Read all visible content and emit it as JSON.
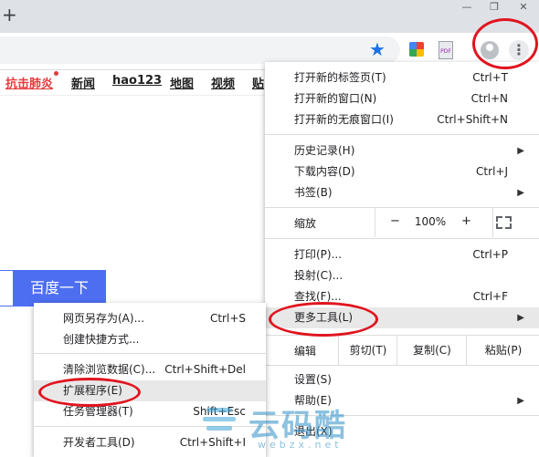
{
  "tabstrip": {
    "new_tab_symbol": "+"
  },
  "toolbar": {
    "star_icon": "star-icon",
    "kebab_glyph": "⋮",
    "pdf_text": "PDF"
  },
  "baidu": {
    "nav": [
      "抗击肺炎",
      "新闻",
      "hao123",
      "地图",
      "视频",
      "贴"
    ],
    "search_button": "百度一下"
  },
  "menu": {
    "items_top": [
      {
        "label": "打开新的标签页(T)",
        "shortcut": "Ctrl+T"
      },
      {
        "label": "打开新的窗口(N)",
        "shortcut": "Ctrl+N"
      },
      {
        "label": "打开新的无痕窗口(I)",
        "shortcut": "Ctrl+Shift+N"
      }
    ],
    "items_history": [
      {
        "label": "历史记录(H)",
        "shortcut": "",
        "arrow": "▶"
      },
      {
        "label": "下载内容(D)",
        "shortcut": "Ctrl+J"
      },
      {
        "label": "书签(B)",
        "shortcut": "",
        "arrow": "▶"
      }
    ],
    "zoom": {
      "label": "缩放",
      "minus": "−",
      "value": "100%",
      "plus": "+"
    },
    "items_tools": [
      {
        "label": "打印(P)...",
        "shortcut": "Ctrl+P"
      },
      {
        "label": "投射(C)...",
        "shortcut": ""
      },
      {
        "label": "查找(F)...",
        "shortcut": "Ctrl+F"
      },
      {
        "label": "更多工具(L)",
        "shortcut": "",
        "arrow": "▶"
      }
    ],
    "edit": {
      "label": "编辑",
      "cut": "剪切(T)",
      "copy": "复制(C)",
      "paste": "粘贴(P)"
    },
    "items_bottom": [
      {
        "label": "设置(S)",
        "shortcut": ""
      },
      {
        "label": "帮助(E)",
        "shortcut": "",
        "arrow": "▶"
      },
      {
        "label": "退出(X)",
        "shortcut": ""
      }
    ]
  },
  "submenu": {
    "items": [
      {
        "label": "网页另存为(A)...",
        "shortcut": "Ctrl+S"
      },
      {
        "label": "创建快捷方式...",
        "shortcut": ""
      },
      {
        "label": "清除浏览数据(C)...",
        "shortcut": "Ctrl+Shift+Del"
      },
      {
        "label": "扩展程序(E)",
        "shortcut": ""
      },
      {
        "label": "任务管理器(T)",
        "shortcut": "Shift+Esc"
      },
      {
        "label": "开发者工具(D)",
        "shortcut": "Ctrl+Shift+I"
      }
    ]
  },
  "watermark": {
    "brand": "云码酷",
    "domain": "webzx.net"
  },
  "colors": {
    "annotation_red": "#e0141e",
    "baidu_blue": "#4e6ef2",
    "chrome_blue": "#1a73e8"
  }
}
